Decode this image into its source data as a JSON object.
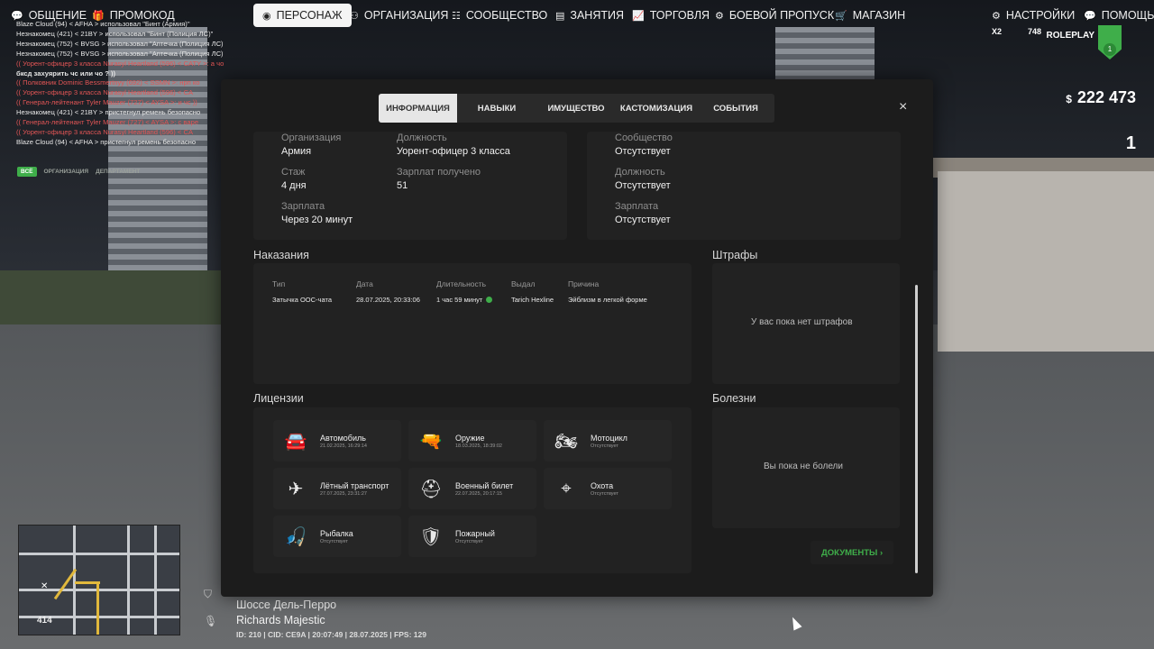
{
  "top_nav": [
    {
      "label": "ОБЩЕНИЕ",
      "icon": "chat-bubble-icon"
    },
    {
      "label": "ПРОМОКОД",
      "icon": "gift-icon"
    },
    {
      "label": "ПЕРСОНАЖ",
      "icon": "user-circle-icon",
      "active": true
    },
    {
      "label": "ОРГАНИЗАЦИЯ",
      "icon": "group-icon"
    },
    {
      "label": "СООБЩЕСТВО",
      "icon": "community-icon"
    },
    {
      "label": "ЗАНЯТИЯ",
      "icon": "clipboard-icon"
    },
    {
      "label": "ТОРГОВЛЯ",
      "icon": "chart-icon"
    },
    {
      "label": "БОЕВОЙ ПРОПУСК",
      "icon": "gear-icon"
    },
    {
      "label": "МАГАЗИН",
      "icon": "cart-icon"
    },
    {
      "label": "НАСТРОЙКИ",
      "icon": "settings-icon"
    },
    {
      "label": "ПОМОЩЬ",
      "icon": "help-icon"
    }
  ],
  "chat": {
    "lines": [
      {
        "text": "Blaze Cloud (94) < AFHA > использовал \"Бинт (Армия)\"",
        "red": false
      },
      {
        "text": "Незнакомец (421) < 21BY > использовал \"Бинт (Полиция ЛС)\"",
        "red": false
      },
      {
        "text": "Незнакомец (752) < BVSG > использовал \"Аптечка (Полиция ЛС)\"",
        "red": false
      },
      {
        "text": "Незнакомец (752) < BVSG > использовал \"Аптечка (Полиция ЛС)\"",
        "red": false
      },
      {
        "text": "(( Уорент-офицер 3 класса Nurasyl Heartland (596) < CATY >: а чо будет если",
        "red": true
      },
      {
        "text": "бксд захуярить чс или чо ? ))",
        "red": false
      },
      {
        "text": "(( Полковник Dominic Bessmertnyy (692) < SSMN >: нрп ко",
        "red": true
      },
      {
        "text": "(( Уорент-офицер 3 класса Nurasyl Heartland (596) < CA",
        "red": true
      },
      {
        "text": "(( Генерал-лейтенант Tyler Mauzer (727) < AYSA >: и чс ))",
        "red": true
      },
      {
        "text": "Незнакомец (421) < 21BY > пристегнул ремень безопасно",
        "red": false
      },
      {
        "text": "(( Генерал-лейтенант Tyler Mauzer (727) < AYSA >: с варе",
        "red": true
      },
      {
        "text": "(( Уорент-офицер 3 класса Nurasyl Heartland (596) < CA",
        "red": true
      },
      {
        "text": "Blaze Cloud (94) < AFHA > пристегнул ремень безопасно",
        "red": false
      }
    ],
    "tabs": [
      "ВСЁ",
      "ОРГАНИЗАЦИЯ",
      "ДЕПАРТАМЕНТ"
    ]
  },
  "hud": {
    "money_symbol": "$",
    "money": "222 473",
    "wanted": "1",
    "brand": "ROLEPLAY",
    "badge": "X2",
    "online": "748",
    "level": "1"
  },
  "minimap": {
    "altitude": "414"
  },
  "location": {
    "street": "Шоссе Дель-Перро",
    "district": "Richards Majestic",
    "stats": "ID: 210 | CID: CE9A | 20:07:49 | 28.07.2025 | FPS: 129"
  },
  "modal": {
    "tabs": [
      {
        "label": "ИНФОРМАЦИЯ",
        "active": true
      },
      {
        "label": "НАВЫКИ",
        "active": false
      },
      {
        "label": "ИМУЩЕСТВО",
        "active": false
      },
      {
        "label": "КАСТОМИЗАЦИЯ",
        "active": false
      },
      {
        "label": "СОБЫТИЯ",
        "active": false
      }
    ],
    "close": "×",
    "org_card": {
      "org_label": "Организация",
      "org_value": "Армия",
      "pos_label": "Должность",
      "pos_value": "Уорент-офицер 3 класса",
      "stage_label": "Стаж",
      "stage_value": "4 дня",
      "salary_got_label": "Зарплат получено",
      "salary_got_value": "51",
      "salary_label": "Зарплата",
      "salary_value": "Через 20 минут"
    },
    "community_card": {
      "comm_label": "Сообщество",
      "comm_value": "Отсутствует",
      "pos_label": "Должность",
      "pos_value": "Отсутствует",
      "salary_label": "Зарплата",
      "salary_value": "Отсутствует"
    },
    "punishments": {
      "title": "Наказания",
      "headers": [
        "Тип",
        "Дата",
        "Длительность",
        "Выдал",
        "Причина"
      ],
      "rows": [
        {
          "type": "Затычка OOC-чата",
          "date": "28.07.2025, 20:33:06",
          "duration": "1 час 59 минут",
          "issuer": "Tarich Hexline",
          "reason": "Эйблизм в легкой форме"
        }
      ]
    },
    "fines": {
      "title": "Штрафы",
      "empty": "У вас пока нет штрафов"
    },
    "licenses": {
      "title": "Лицензии",
      "items": [
        {
          "name": "Автомобиль",
          "date": "21.02.2025, 16:29:14",
          "icon": "car-icon",
          "glyph": "🚘"
        },
        {
          "name": "Оружие",
          "date": "18.03.2025, 18:39:02",
          "icon": "rifle-icon",
          "glyph": "🔫"
        },
        {
          "name": "Мотоцикл",
          "date": "Отсутствует",
          "icon": "motorcycle-icon",
          "glyph": "🏍"
        },
        {
          "name": "Лётный транспорт",
          "date": "27.07.2025, 23:31:27",
          "icon": "airplane-icon",
          "glyph": "✈"
        },
        {
          "name": "Военный билет",
          "date": "22.07.2025, 20:17:15",
          "icon": "helmet-icon",
          "glyph": "⛑"
        },
        {
          "name": "Охота",
          "date": "Отсутствует",
          "icon": "crosshair-icon",
          "glyph": "⌖"
        },
        {
          "name": "Рыбалка",
          "date": "Отсутствует",
          "icon": "fish-hook-icon",
          "glyph": "🎣"
        },
        {
          "name": "Пожарный",
          "date": "Отсутствует",
          "icon": "fire-shield-icon",
          "glyph": "🛡"
        }
      ]
    },
    "illnesses": {
      "title": "Болезни",
      "empty": "Вы пока не болели"
    },
    "documents_button": "ДОКУМЕНТЫ ›"
  },
  "colors": {
    "accent": "#3fae4a",
    "panel": "#1c1c1c",
    "card": "#222222"
  }
}
